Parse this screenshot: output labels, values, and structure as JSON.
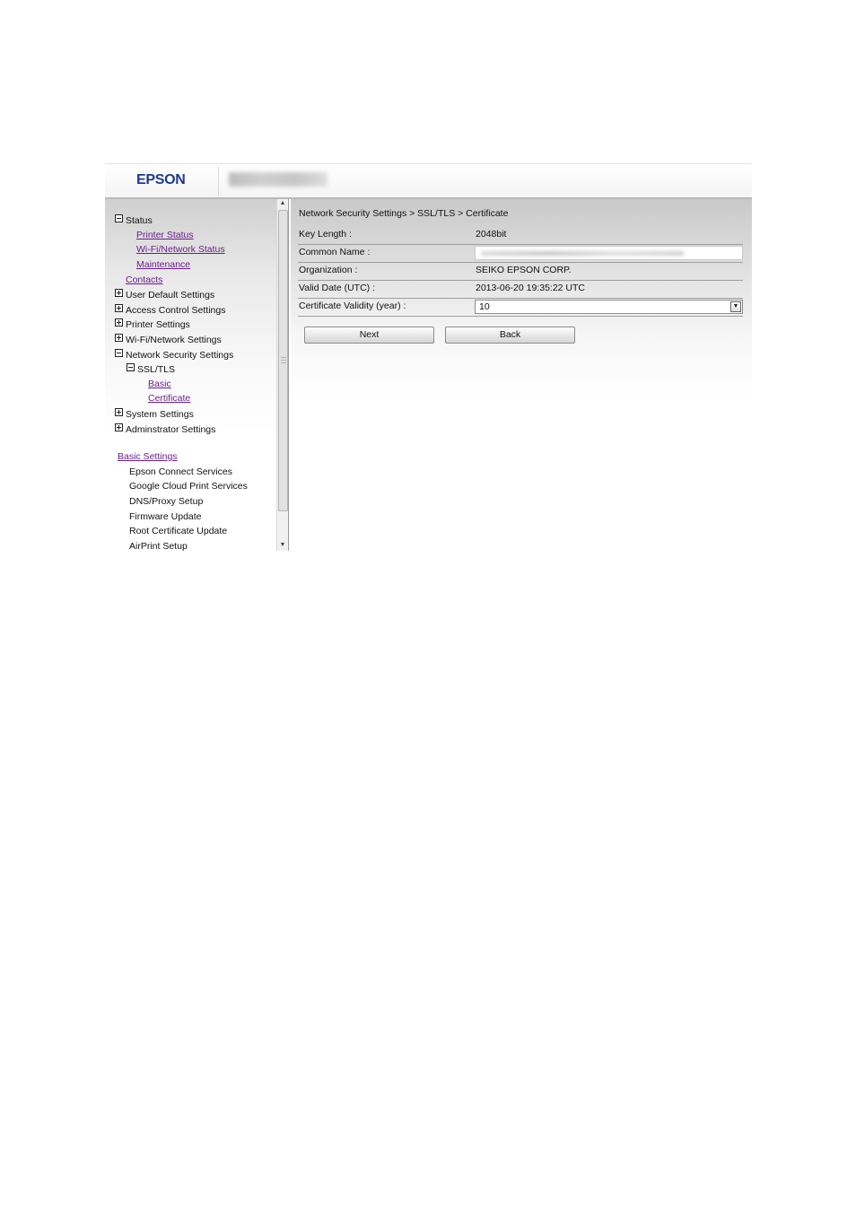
{
  "header": {
    "logo": "EPSON",
    "model_name_obscured": true
  },
  "sidebar": {
    "status": {
      "label": "Status",
      "expanded": true,
      "children": [
        "Printer Status",
        "Wi-Fi/Network Status",
        "Maintenance"
      ]
    },
    "contacts": "Contacts",
    "user_default": {
      "label": "User Default Settings",
      "expanded": false
    },
    "access_control": {
      "label": "Access Control Settings",
      "expanded": false
    },
    "printer_settings": {
      "label": "Printer Settings",
      "expanded": false
    },
    "wifi_network": {
      "label": "Wi-Fi/Network Settings",
      "expanded": false
    },
    "network_security": {
      "label": "Network Security Settings",
      "expanded": true,
      "ssl": {
        "label": "SSL/TLS",
        "expanded": true,
        "children": [
          "Basic",
          "Certificate"
        ]
      }
    },
    "system_settings": {
      "label": "System Settings",
      "expanded": false
    },
    "admin_settings": {
      "label": "Adminstrator Settings",
      "expanded": false
    },
    "basic_settings": {
      "label": "Basic Settings",
      "items": [
        "Epson Connect Services",
        "Google Cloud Print Services",
        "DNS/Proxy Setup",
        "Firmware Update",
        "Root Certificate Update",
        "AirPrint Setup"
      ]
    }
  },
  "main": {
    "breadcrumb": "Network Security Settings > SSL/TLS > Certificate",
    "fields": {
      "key_length": {
        "label": "Key Length :",
        "value": "2048bit"
      },
      "common_name": {
        "label": "Common Name :",
        "value_obscured": true
      },
      "organization": {
        "label": "Organization :",
        "value": "SEIKO EPSON CORP."
      },
      "valid_date": {
        "label": "Valid Date (UTC) :",
        "value": "2013-06-20 19:35:22 UTC"
      },
      "validity": {
        "label": "Certificate Validity (year) :",
        "value": "10"
      }
    },
    "buttons": {
      "next": "Next",
      "back": "Back"
    }
  },
  "colors": {
    "link": "#6b1d8e",
    "logo": "#1e3a8c"
  }
}
